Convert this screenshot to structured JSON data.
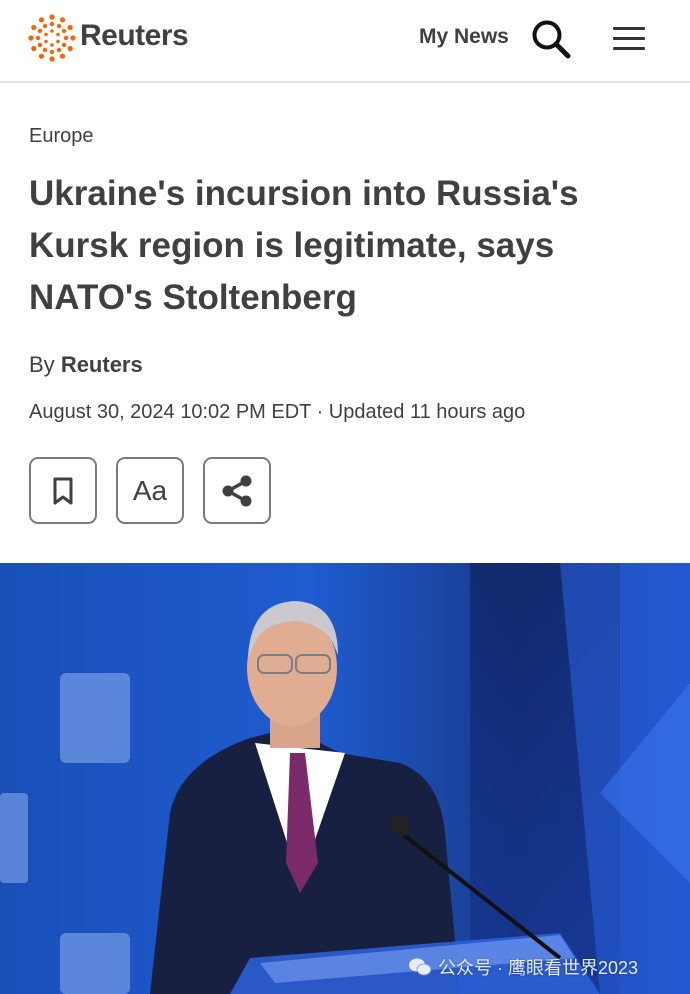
{
  "header": {
    "brand": "Reuters",
    "my_news_label": "My News",
    "icons": {
      "logo": "reuters-dot-ring-icon",
      "search": "search-icon",
      "menu": "hamburger-menu-icon"
    },
    "accent_color": "#fa6400"
  },
  "article": {
    "section": "Europe",
    "headline": "Ukraine's incursion into Russia's Kursk region is legitimate, says NATO's Stoltenberg",
    "byline_prefix": "By",
    "author": "Reuters",
    "dateline": "August 30, 2024 10:02 PM EDT · Updated 11 hours ago",
    "actions": {
      "bookmark_icon": "bookmark-icon",
      "text_size_label": "Aa",
      "share_icon": "share-icon"
    }
  },
  "watermark": {
    "icon": "wechat-icon",
    "text": "公众号 · 鹰眼看世界2023"
  }
}
